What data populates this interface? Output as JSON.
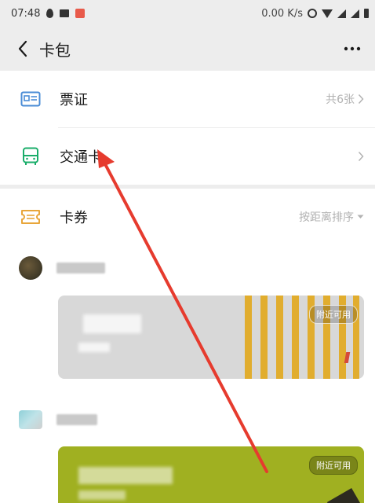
{
  "status": {
    "time": "07:48",
    "speed": "0.00 K/s"
  },
  "nav": {
    "title": "卡包"
  },
  "rows": {
    "tickets": {
      "label": "票证",
      "count": "共6张"
    },
    "transit": {
      "label": "交通卡"
    },
    "coupons": {
      "label": "卡券",
      "sort": "按距离排序"
    }
  },
  "cards": {
    "first_tag": "附近可用",
    "second_tag": "附近可用"
  },
  "colors": {
    "accent_blue": "#4a8cd6",
    "accent_green": "#1aad6a",
    "accent_orange": "#e8a63a",
    "card_gray": "#d8d8d8",
    "card_stripe": "#e1ad2e",
    "card_olive": "#a0b021",
    "annotation_arrow": "#e63b2e"
  },
  "icons": {
    "tickets": "ticket-card-icon",
    "transit": "bus-icon",
    "coupons": "coupon-icon"
  }
}
